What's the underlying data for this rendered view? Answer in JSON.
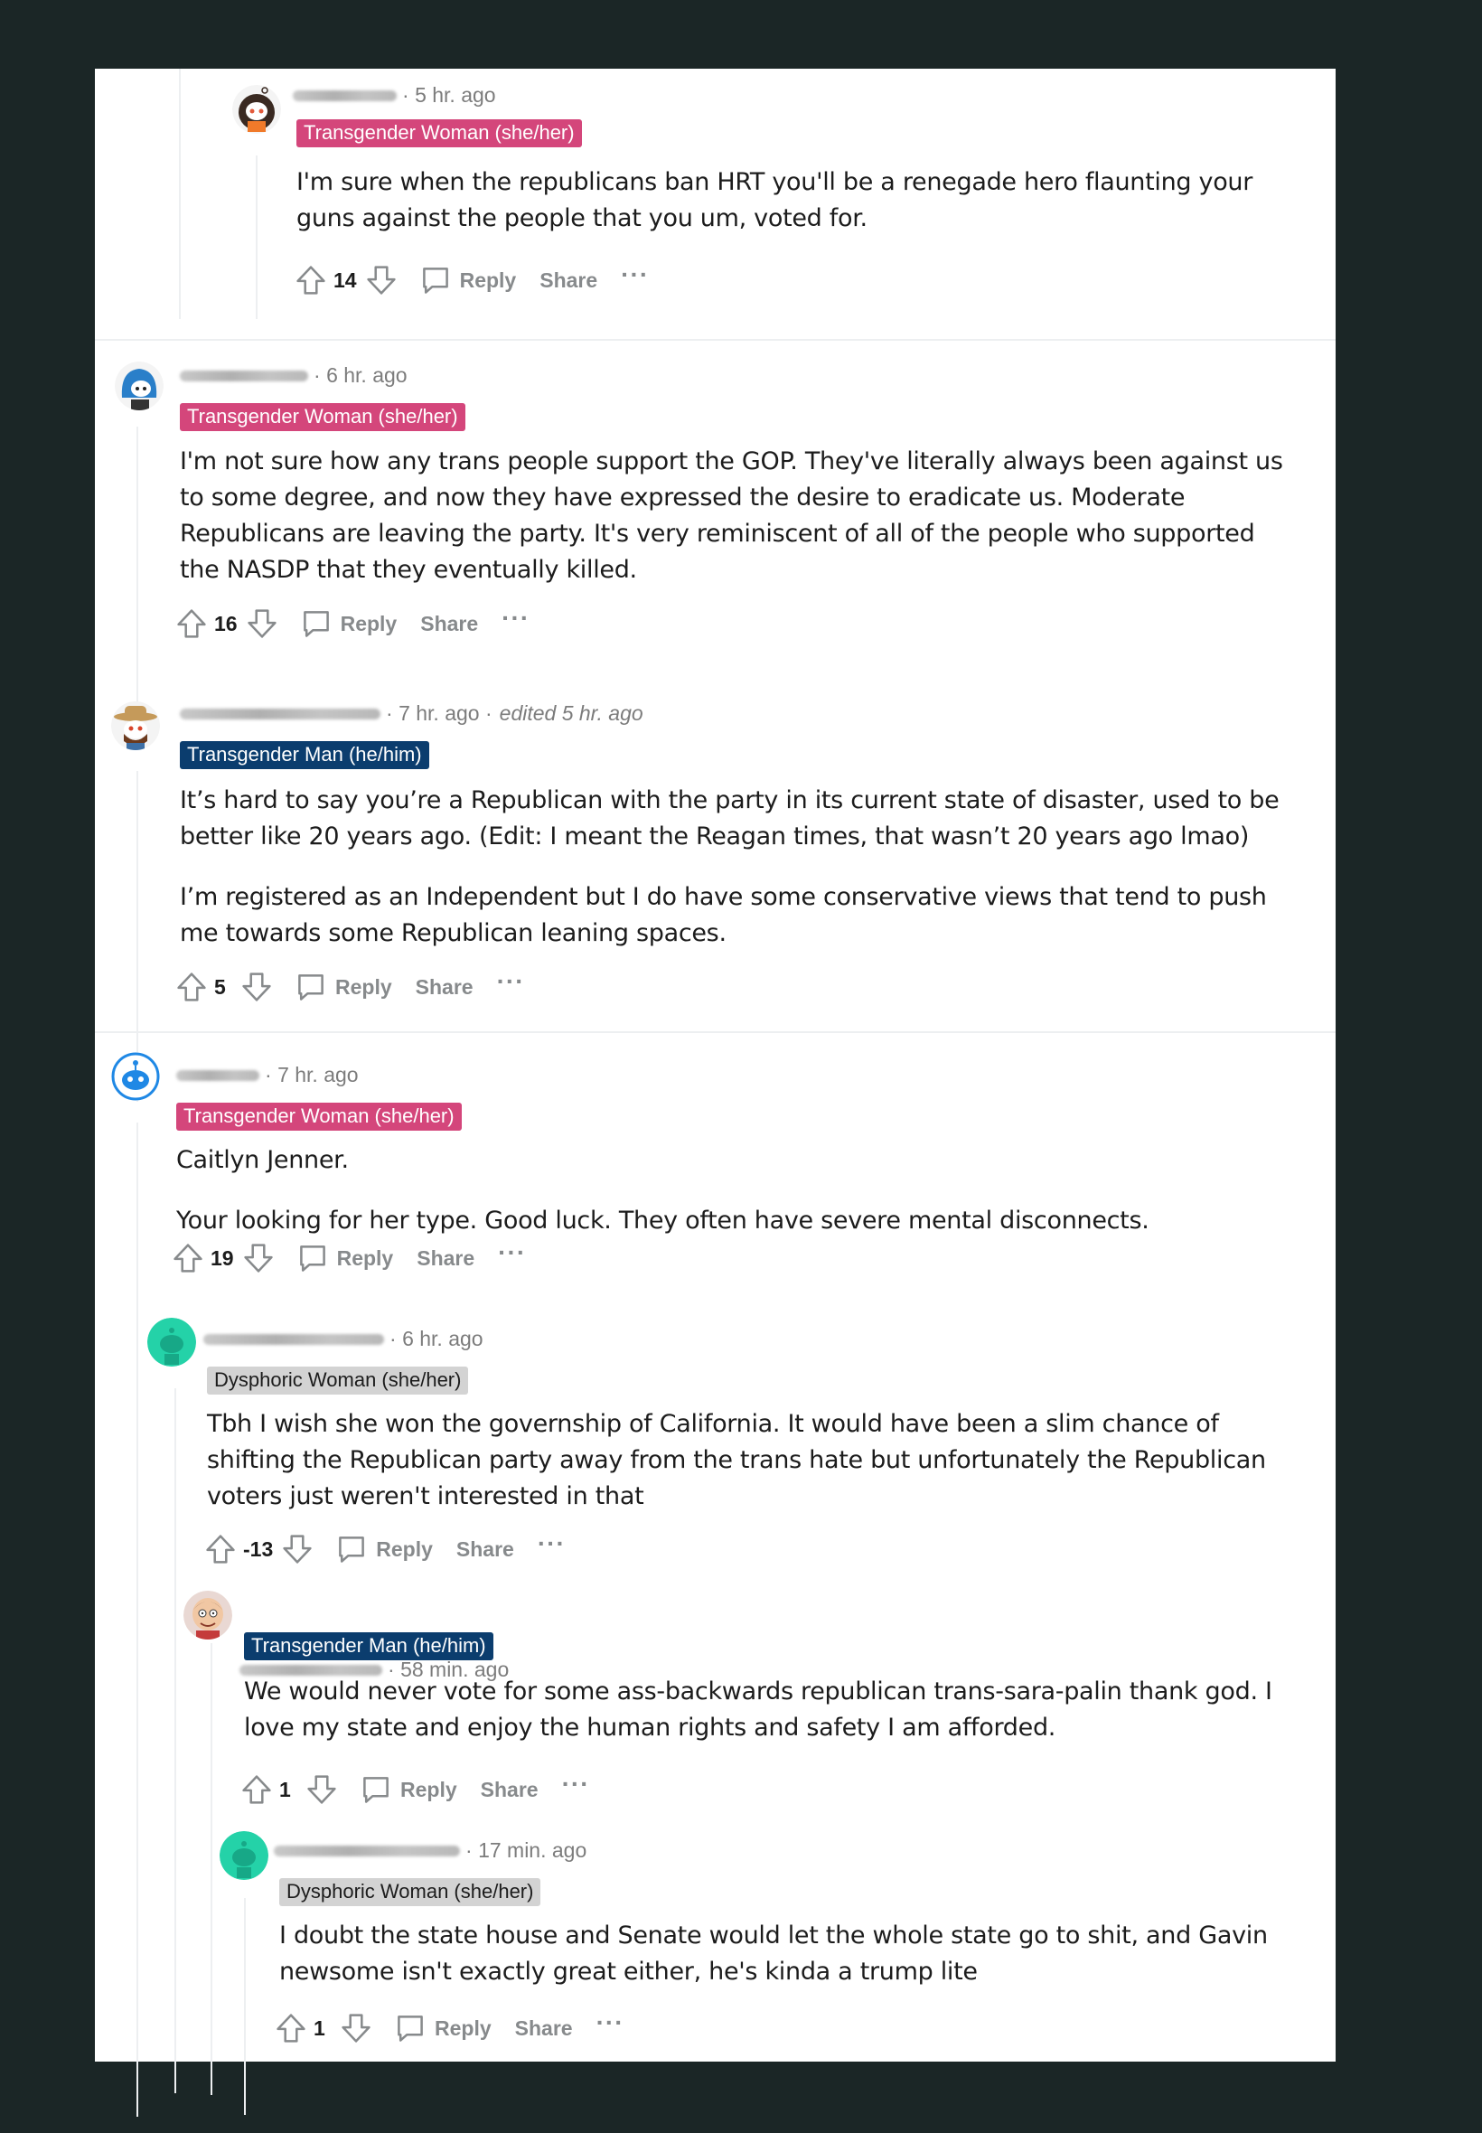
{
  "comments": [
    {
      "time": "5 hr. ago",
      "flair": "Transgender Woman (she/her)",
      "flair_color": "#d4467b",
      "avatar": "snoo-curly-hair-avatar",
      "paragraphs": [
        "I'm sure when the republicans ban HRT you'll be a renegade hero flaunting your guns against the people that you um, voted for."
      ],
      "score": "14"
    },
    {
      "time": "6 hr. ago",
      "flair": "Transgender Woman (she/her)",
      "flair_color": "#d4467b",
      "avatar": "snoo-blue-hair-avatar",
      "paragraphs": [
        "I'm not sure how any trans people support the GOP. They've literally always been against us to some degree, and now they have expressed the desire to eradicate us. Moderate Republicans are leaving the party. It's very reminiscent of all of the people who supported the NASDP that they eventually killed."
      ],
      "score": "16"
    },
    {
      "time": "7 hr. ago",
      "edited": "edited 5 hr. ago",
      "flair": "Transgender Man (he/him)",
      "flair_color": "#0b3d6e",
      "avatar": "snoo-cowboy-hat-avatar",
      "paragraphs": [
        "It’s hard to say you’re a Republican with the party in its current state of disaster, used to be better like 20 years ago. (Edit: I meant the Reagan times, that wasn’t 20 years ago lmao)",
        "I’m registered as an Independent but I do have some conservative views that tend to push me towards some Republican leaning spaces."
      ],
      "score": "5"
    },
    {
      "time": "7 hr. ago",
      "flair": "Transgender Woman (she/her)",
      "flair_color": "#d4467b",
      "avatar": "snoo-default-blue-avatar",
      "paragraphs": [
        "Caitlyn Jenner.",
        "Your looking for her type. Good luck. They often have severe mental disconnects."
      ],
      "score": "19"
    },
    {
      "time": "6 hr. ago",
      "flair": "Dysphoric Woman (she/her)",
      "flair_color": "#d3d3d3",
      "avatar": "snoo-teal-avatar",
      "paragraphs": [
        "Tbh I wish she won the governship of California. It would have been a slim chance of shifting the Republican party away from the trans hate but unfortunately the Republican voters just weren't interested in that"
      ],
      "score": "-13"
    },
    {
      "time": "58 min. ago",
      "flair": "Transgender Man (he/him)",
      "flair_color": "#0b3d6e",
      "avatar": "snoo-cartoon-face-avatar",
      "paragraphs": [
        "We would never vote for some ass-backwards republican trans-sara-palin thank god. I love my state and enjoy the human rights and safety I am afforded."
      ],
      "score": "1"
    },
    {
      "time": "17 min. ago",
      "flair": "Dysphoric Woman (she/her)",
      "flair_color": "#d3d3d3",
      "avatar": "snoo-teal-avatar",
      "paragraphs": [
        "I doubt the state house and Senate would let the whole state go to shit, and Gavin newsome isn't exactly great either, he's kinda a trump lite"
      ],
      "score": "1"
    }
  ],
  "labels": {
    "reply": "Reply",
    "share": "Share",
    "more": "···"
  }
}
